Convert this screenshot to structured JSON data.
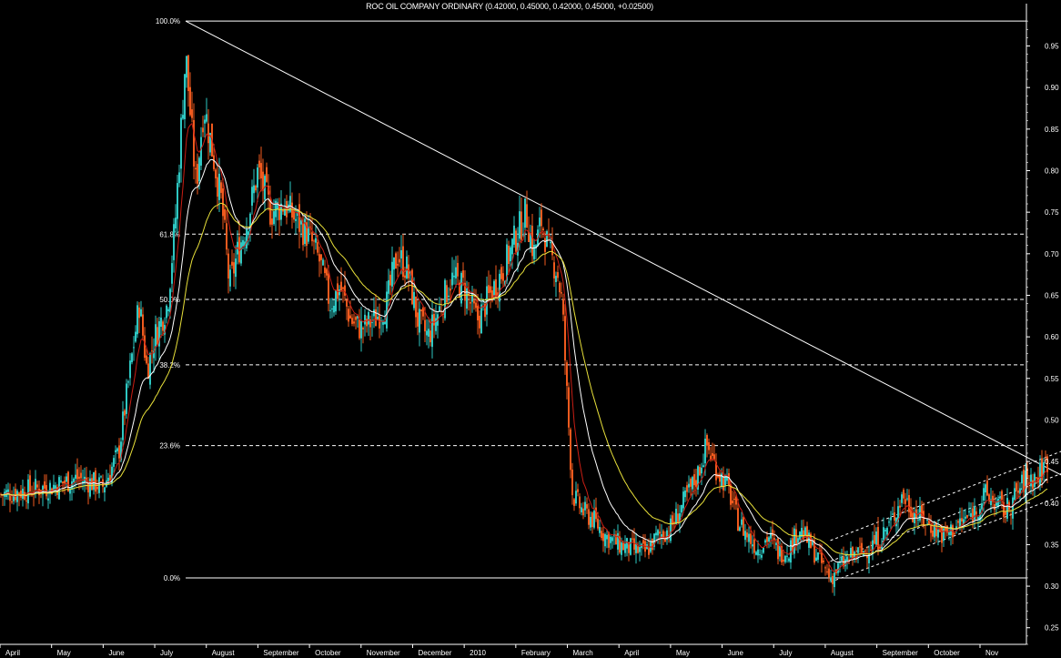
{
  "chart_data": {
    "type": "candlestick",
    "title": "ROC OIL COMPANY ORDINARY (0.42000, 0.45000, 0.42000, 0.45000, +0.02500)",
    "ylim": [
      0.23,
      0.99
    ],
    "yticks": [
      "0.25",
      "0.30",
      "0.35",
      "0.40",
      "0.45",
      "0.50",
      "0.55",
      "0.60",
      "0.65",
      "0.70",
      "0.75",
      "0.80",
      "0.85",
      "0.90",
      "0.95"
    ],
    "months": [
      "April",
      "May",
      "June",
      "July",
      "August",
      "September",
      "October",
      "November",
      "December",
      "2010",
      "February",
      "March",
      "April",
      "May",
      "June",
      "July",
      "August",
      "September",
      "October",
      "Nov"
    ],
    "fib_levels": [
      {
        "label": "100.0%",
        "price": 0.98,
        "style": "solid"
      },
      {
        "label": "61.8%",
        "price": 0.7236,
        "style": "dashed"
      },
      {
        "label": "50.0%",
        "price": 0.645,
        "style": "dashed"
      },
      {
        "label": "38.2%",
        "price": 0.5664,
        "style": "dashed"
      },
      {
        "label": "23.6%",
        "price": 0.4692,
        "style": "dashed"
      },
      {
        "label": "0.0%",
        "price": 0.31,
        "style": "solid"
      }
    ],
    "price_path": [
      [
        0.0,
        0.41
      ],
      [
        2.0,
        0.42
      ],
      [
        3.0,
        0.43
      ],
      [
        4.0,
        0.42
      ],
      [
        4.6,
        0.46
      ],
      [
        5.0,
        0.55
      ],
      [
        5.4,
        0.64
      ],
      [
        5.7,
        0.56
      ],
      [
        6.0,
        0.6
      ],
      [
        6.5,
        0.64
      ],
      [
        6.8,
        0.74
      ],
      [
        7.2,
        0.94
      ],
      [
        7.6,
        0.78
      ],
      [
        7.9,
        0.88
      ],
      [
        8.2,
        0.83
      ],
      [
        8.6,
        0.76
      ],
      [
        8.9,
        0.66
      ],
      [
        9.2,
        0.7
      ],
      [
        9.6,
        0.74
      ],
      [
        10.0,
        0.8
      ],
      [
        10.5,
        0.75
      ],
      [
        11.0,
        0.76
      ],
      [
        11.5,
        0.74
      ],
      [
        12.0,
        0.72
      ],
      [
        12.4,
        0.69
      ],
      [
        12.8,
        0.64
      ],
      [
        13.2,
        0.66
      ],
      [
        13.6,
        0.62
      ],
      [
        14.0,
        0.61
      ],
      [
        14.5,
        0.62
      ],
      [
        15.0,
        0.64
      ],
      [
        15.4,
        0.7
      ],
      [
        15.8,
        0.68
      ],
      [
        16.2,
        0.62
      ],
      [
        16.6,
        0.6
      ],
      [
        17.0,
        0.63
      ],
      [
        17.5,
        0.67
      ],
      [
        18.0,
        0.66
      ],
      [
        18.5,
        0.62
      ],
      [
        19.0,
        0.65
      ],
      [
        19.5,
        0.68
      ],
      [
        20.0,
        0.72
      ],
      [
        20.4,
        0.75
      ],
      [
        20.7,
        0.7
      ],
      [
        21.0,
        0.74
      ],
      [
        21.3,
        0.7
      ],
      [
        21.6,
        0.68
      ],
      [
        21.8,
        0.64
      ],
      [
        22.0,
        0.52
      ],
      [
        22.2,
        0.41
      ],
      [
        22.6,
        0.39
      ],
      [
        23.0,
        0.38
      ],
      [
        23.5,
        0.36
      ],
      [
        24.0,
        0.35
      ],
      [
        24.5,
        0.345
      ],
      [
        25.0,
        0.34
      ],
      [
        25.5,
        0.36
      ],
      [
        26.0,
        0.37
      ],
      [
        26.5,
        0.4
      ],
      [
        27.0,
        0.43
      ],
      [
        27.4,
        0.47
      ],
      [
        27.8,
        0.44
      ],
      [
        28.2,
        0.42
      ],
      [
        28.6,
        0.38
      ],
      [
        29.0,
        0.36
      ],
      [
        29.4,
        0.345
      ],
      [
        29.8,
        0.36
      ],
      [
        30.2,
        0.34
      ],
      [
        30.6,
        0.345
      ],
      [
        31.0,
        0.37
      ],
      [
        31.4,
        0.35
      ],
      [
        31.8,
        0.33
      ],
      [
        32.2,
        0.31
      ],
      [
        32.6,
        0.325
      ],
      [
        33.0,
        0.335
      ],
      [
        33.4,
        0.34
      ],
      [
        33.8,
        0.35
      ],
      [
        34.2,
        0.36
      ],
      [
        34.6,
        0.38
      ],
      [
        35.0,
        0.41
      ],
      [
        35.4,
        0.39
      ],
      [
        35.8,
        0.38
      ],
      [
        36.2,
        0.37
      ],
      [
        36.6,
        0.36
      ],
      [
        37.0,
        0.37
      ],
      [
        37.4,
        0.38
      ],
      [
        37.8,
        0.39
      ],
      [
        38.2,
        0.41
      ],
      [
        38.6,
        0.4
      ],
      [
        39.0,
        0.39
      ],
      [
        39.4,
        0.41
      ],
      [
        39.8,
        0.43
      ],
      [
        40.2,
        0.43
      ],
      [
        40.6,
        0.45
      ]
    ],
    "trendline": {
      "from": [
        7.2,
        0.98
      ],
      "to": [
        42.0,
        0.42
      ]
    },
    "channel": [
      {
        "from": [
          32.2,
          0.305
        ],
        "to": [
          41.8,
          0.416
        ]
      },
      {
        "from": [
          32.2,
          0.33
        ],
        "to": [
          41.8,
          0.443
        ]
      },
      {
        "from": [
          32.2,
          0.355
        ],
        "to": [
          41.8,
          0.47
        ]
      }
    ]
  }
}
